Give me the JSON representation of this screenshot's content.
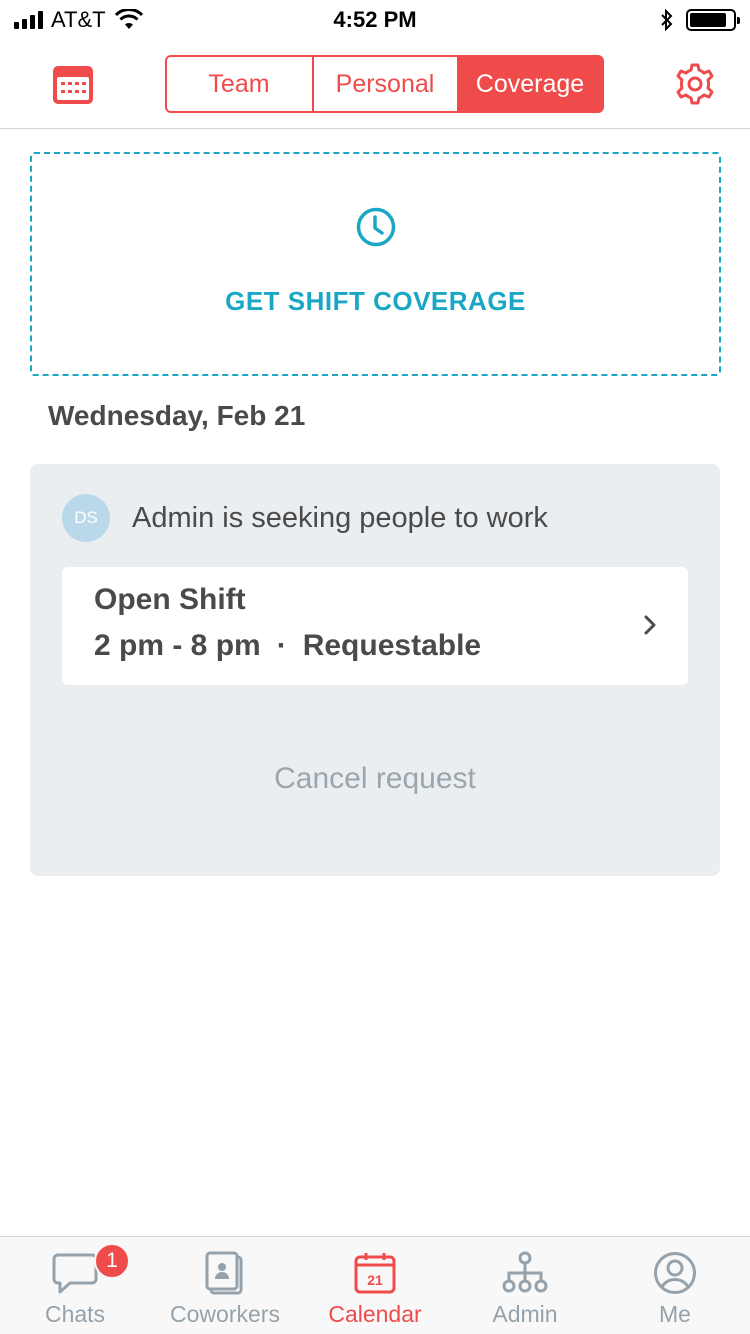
{
  "status_bar": {
    "carrier": "AT&T",
    "time": "4:52 PM"
  },
  "header": {
    "tabs": [
      {
        "label": "Team",
        "active": false
      },
      {
        "label": "Personal",
        "active": false
      },
      {
        "label": "Coverage",
        "active": true
      }
    ],
    "left_icon": "calendar-icon",
    "right_icon": "gear-icon"
  },
  "coverage": {
    "icon": "clock-icon",
    "label": "GET SHIFT COVERAGE"
  },
  "date_heading": "Wednesday, Feb 21",
  "request": {
    "avatar_initials": "DS",
    "message": "Admin is seeking people to work",
    "shift": {
      "title": "Open Shift",
      "time": "2 pm - 8 pm",
      "separator": "·",
      "status": "Requestable"
    },
    "cancel_label": "Cancel request"
  },
  "tab_bar": {
    "items": [
      {
        "label": "Chats",
        "icon": "chat-icon",
        "badge": "1"
      },
      {
        "label": "Coworkers",
        "icon": "contacts-icon"
      },
      {
        "label": "Calendar",
        "icon": "calendar-icon",
        "icon_text": "21",
        "active": true
      },
      {
        "label": "Admin",
        "icon": "org-chart-icon"
      },
      {
        "label": "Me",
        "icon": "profile-icon"
      }
    ]
  },
  "colors": {
    "accent": "#ef4b4b",
    "teal": "#1aa7c4",
    "muted": "#95a2ab"
  }
}
